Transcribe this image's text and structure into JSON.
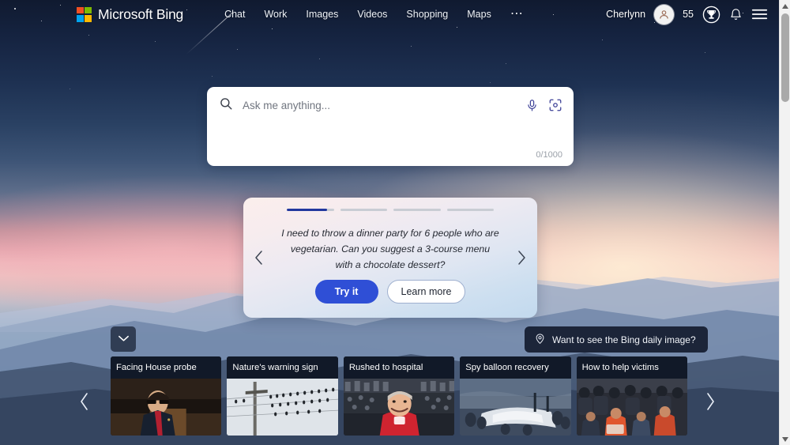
{
  "header": {
    "logo": {
      "text": "Microsoft Bing",
      "icon": "microsoft-logo-icon",
      "colors": {
        "red": "#f25022",
        "green": "#7fba00",
        "blue": "#00a4ef",
        "yellow": "#ffb900"
      }
    },
    "nav": [
      {
        "label": "Chat",
        "name": "nav-item-chat"
      },
      {
        "label": "Work",
        "name": "nav-item-work"
      },
      {
        "label": "Images",
        "name": "nav-item-images"
      },
      {
        "label": "Videos",
        "name": "nav-item-videos"
      },
      {
        "label": "Shopping",
        "name": "nav-item-shopping"
      },
      {
        "label": "Maps",
        "name": "nav-item-maps"
      }
    ],
    "more_label": "⋯",
    "user_name": "Cherlynn",
    "rewards_points": "55",
    "icons": {
      "avatar": "user-avatar-icon",
      "rewards": "rewards-trophy-icon",
      "notifications": "bell-icon",
      "menu": "hamburger-menu-icon"
    }
  },
  "search": {
    "placeholder": "Ask me anything...",
    "value": "",
    "char_count": "0/1000",
    "icons": {
      "search": "search-icon",
      "microphone": "microphone-icon",
      "visual_search": "visual-search-camera-icon"
    }
  },
  "suggestion_card": {
    "text": "I need to throw a dinner party for 6 people who are vegetarian. Can you suggest a 3-course menu with a chocolate dessert?",
    "try_label": "Try it",
    "learn_label": "Learn more",
    "progress": [
      85,
      0,
      0,
      0
    ],
    "prev_icon": "chevron-left-icon",
    "next_icon": "chevron-right-icon",
    "accent_color": "#2f4fd6",
    "progress_fill_color": "#22389e"
  },
  "daily_image_prompt": {
    "label": "Want to see the Bing daily image?",
    "icon": "location-pin-icon"
  },
  "collapse_button": {
    "icon": "chevron-down-icon"
  },
  "news": {
    "prev_icon": "chevron-left-icon",
    "next_icon": "chevron-right-icon",
    "cards": [
      {
        "title": "Facing House probe"
      },
      {
        "title": "Nature's warning sign"
      },
      {
        "title": "Rushed to hospital"
      },
      {
        "title": "Spy balloon recovery"
      },
      {
        "title": "How to help victims"
      }
    ]
  },
  "scrollbar": {
    "up_icon": "scroll-up-arrow-icon",
    "down_icon": "scroll-down-arrow-icon"
  }
}
